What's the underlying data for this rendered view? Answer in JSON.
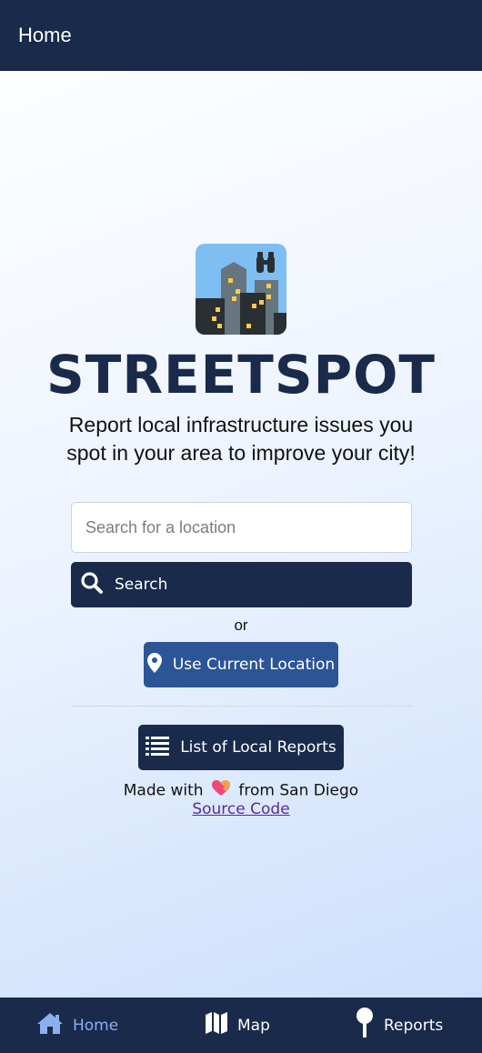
{
  "header": {
    "title": "Home"
  },
  "hero": {
    "brand": "STREETSPOT",
    "tagline_line1": "Report local infrastructure issues you",
    "tagline_line2": "spot in your area to improve your city!",
    "logo_icon": "city-binoculars-icon"
  },
  "search": {
    "placeholder": "Search for a location",
    "value": "",
    "button_label": "Search"
  },
  "or_text": "or",
  "location_button": {
    "label": "Use Current Location"
  },
  "reports_button": {
    "label": "List of Local Reports"
  },
  "footer": {
    "made_prefix": "Made with",
    "made_suffix": "from San Diego",
    "source_link": "Source Code"
  },
  "nav": {
    "items": [
      {
        "label": "Home",
        "icon": "home-icon",
        "active": true
      },
      {
        "label": "Map",
        "icon": "map-icon",
        "active": false
      },
      {
        "label": "Reports",
        "icon": "pin-icon",
        "active": false
      }
    ]
  },
  "colors": {
    "navy": "#192a4b",
    "blue_button": "#2c5596",
    "active_nav": "#8ab0ee",
    "link": "#5b2a9c"
  }
}
